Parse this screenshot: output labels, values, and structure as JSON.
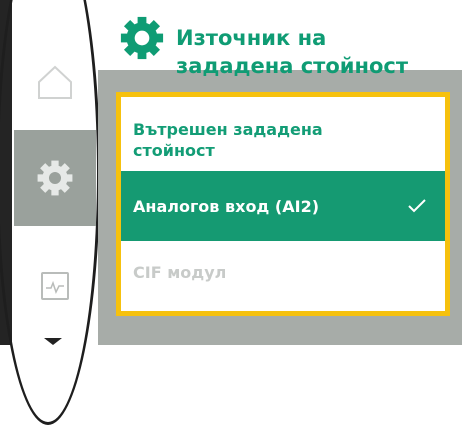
{
  "header": {
    "title_line1": "Източник на",
    "title_line2": "зададена стойност",
    "icon": "gear-icon"
  },
  "sidebar": {
    "items": [
      {
        "name": "home",
        "icon": "home-icon"
      },
      {
        "name": "settings",
        "icon": "gear-icon",
        "selected": true
      },
      {
        "name": "trend",
        "icon": "trend-icon"
      }
    ]
  },
  "menu": {
    "items": [
      {
        "label_line1": "Вътрешен зададена",
        "label_line2": "стойност",
        "state": "normal"
      },
      {
        "label": "Аналогов вход (AI2)",
        "state": "selected"
      },
      {
        "label": "CIF модул",
        "state": "disabled"
      }
    ]
  },
  "colors": {
    "accent": "#0f9c74",
    "selected_bg": "#159a72",
    "focus_border": "#f6c10e",
    "panel_bg": "#a7aca8",
    "nav_selected_bg": "#9aa19c",
    "disabled_text": "#c8cbc9"
  }
}
